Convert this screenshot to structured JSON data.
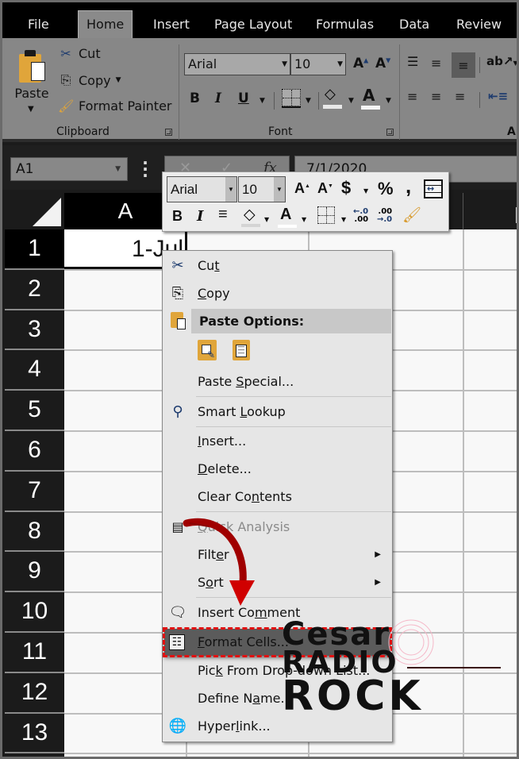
{
  "tabs": [
    {
      "label": "File",
      "active": false
    },
    {
      "label": "Home",
      "active": true
    },
    {
      "label": "Insert",
      "active": false
    },
    {
      "label": "Page Layout",
      "active": false
    },
    {
      "label": "Formulas",
      "active": false
    },
    {
      "label": "Data",
      "active": false
    },
    {
      "label": "Review",
      "active": false
    }
  ],
  "ribbon": {
    "clipboard": {
      "paste_label": "Paste",
      "cut_label": "Cut",
      "copy_label": "Copy",
      "format_painter_label": "Format Painter",
      "group_label": "Clipboard"
    },
    "font": {
      "font_name": "Arial",
      "font_size": "10",
      "bold": "B",
      "italic": "I",
      "underline": "U",
      "grow_font": "A",
      "shrink_font": "A",
      "font_color": "A",
      "group_label": "Font"
    },
    "alignment": {
      "group_label_partial": "Al"
    }
  },
  "formula_bar": {
    "name_box": "A1",
    "fx_label": "fx",
    "cancel_symbol": "✕",
    "enter_symbol": "✓",
    "formula_value": "7/1/2020"
  },
  "grid": {
    "column_headers": [
      "A"
    ],
    "row_headers": [
      "1",
      "2",
      "3",
      "4",
      "5",
      "6",
      "7",
      "8",
      "9",
      "10",
      "11",
      "12",
      "13"
    ],
    "cells": {
      "A1": "1-Jul"
    }
  },
  "mini_toolbar": {
    "font_name": "Arial",
    "font_size": "10",
    "grow": "A",
    "shrink": "A",
    "currency": "$",
    "percent": "%",
    "comma": ",",
    "bold": "B",
    "italic": "I",
    "font_color": "A",
    "increase_decimal_top": "←.0",
    "increase_decimal_bottom": ".00",
    "decrease_decimal_top": ".00",
    "decrease_decimal_bottom": "→.0"
  },
  "context_menu": {
    "items": [
      {
        "id": "cut",
        "pre": "Cu",
        "accel": "t",
        "post": "",
        "icon": "scissors-icon"
      },
      {
        "id": "copy",
        "pre": "",
        "accel": "C",
        "post": "opy",
        "icon": "copy-icon"
      },
      {
        "id": "paste_options",
        "label": "Paste Options:",
        "icon": "paste-icon"
      },
      {
        "id": "paste_special",
        "pre": "Paste ",
        "accel": "S",
        "post": "pecial...",
        "icon": ""
      },
      {
        "id": "smart_lookup",
        "pre": "Smart ",
        "accel": "L",
        "post": "ookup",
        "icon": "smart-lookup-icon"
      },
      {
        "id": "insert",
        "pre": "",
        "accel": "I",
        "post": "nsert...",
        "icon": ""
      },
      {
        "id": "delete",
        "pre": "",
        "accel": "D",
        "post": "elete...",
        "icon": ""
      },
      {
        "id": "clear_contents",
        "pre": "Clear Co",
        "accel": "n",
        "post": "tents",
        "icon": ""
      },
      {
        "id": "quick_analysis",
        "pre": "",
        "accel": "Q",
        "post": "uick Analysis",
        "icon": "quick-analysis-icon",
        "disabled": true
      },
      {
        "id": "filter",
        "pre": "Filt",
        "accel": "e",
        "post": "r",
        "icon": "",
        "submenu": true
      },
      {
        "id": "sort",
        "pre": "S",
        "accel": "o",
        "post": "rt",
        "icon": "",
        "submenu": true
      },
      {
        "id": "insert_comment",
        "pre": "Insert Co",
        "accel": "m",
        "post": "ment",
        "icon": "comment-icon"
      },
      {
        "id": "format_cells",
        "pre": "",
        "accel": "F",
        "post": "ormat Cells...",
        "icon": "format-cells-icon",
        "highlighted": true
      },
      {
        "id": "pick_from_list",
        "pre": "Pic",
        "accel": "k",
        "post": " From Drop-down List...",
        "icon": ""
      },
      {
        "id": "define_name",
        "pre": "Define N",
        "accel": "a",
        "post": "me...",
        "icon": ""
      },
      {
        "id": "hyperlink",
        "pre": "Hyper",
        "accel": "l",
        "post": "ink...",
        "icon": "hyperlink-icon"
      }
    ]
  },
  "watermark": {
    "line1": "Cesar",
    "line2": "RADIO",
    "line3": "ROCK"
  },
  "colors": {
    "highlight_outline": "#e01010",
    "arrow": "#b00000",
    "clipboard_accent": "#e0a53a"
  }
}
